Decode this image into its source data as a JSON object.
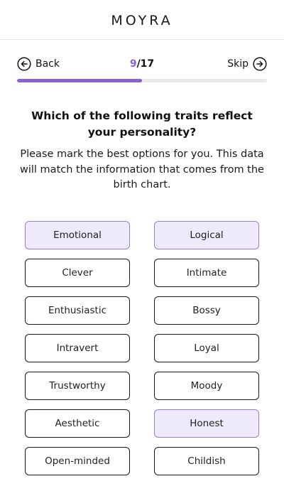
{
  "header": {
    "logo": "MOYRA"
  },
  "nav": {
    "back_label": "Back",
    "skip_label": "Skip",
    "progress_current": "9",
    "progress_total": "/17",
    "progress_fraction": 0.5
  },
  "question": {
    "title": "Which of the following traits reflect your personality?",
    "subtitle": "Please mark the best options for you. This data will match the information that comes from the birth chart."
  },
  "traits": [
    {
      "label": "Emotional",
      "selected": true
    },
    {
      "label": "Logical",
      "selected": true
    },
    {
      "label": "Clever",
      "selected": false
    },
    {
      "label": "Intimate",
      "selected": false
    },
    {
      "label": "Enthusiastic",
      "selected": false
    },
    {
      "label": "Bossy",
      "selected": false
    },
    {
      "label": "Intravert",
      "selected": false
    },
    {
      "label": "Loyal",
      "selected": false
    },
    {
      "label": "Trustworthy",
      "selected": false
    },
    {
      "label": "Moody",
      "selected": false
    },
    {
      "label": "Aesthetic",
      "selected": false
    },
    {
      "label": "Honest",
      "selected": true
    },
    {
      "label": "Open-minded",
      "selected": false
    },
    {
      "label": "Childish",
      "selected": false
    }
  ],
  "colors": {
    "accent": "#8a63d2",
    "selected_bg": "#efeaf9",
    "selected_border": "#9b7bd8",
    "track": "#e9e9e9"
  }
}
